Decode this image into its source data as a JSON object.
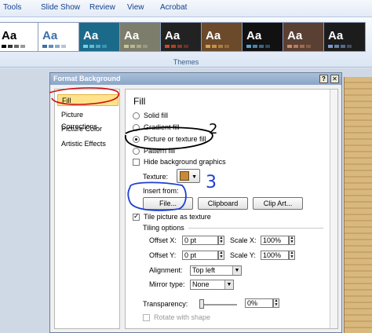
{
  "menubar": {
    "items": [
      "Tools",
      "Slide Show",
      "Review",
      "View",
      "Acrobat"
    ]
  },
  "ribbon": {
    "group_label": "Themes",
    "themes": [
      {
        "label": "Aa",
        "bg": "#ffffff",
        "fg": "#000000",
        "accent": "#000000"
      },
      {
        "label": "Aa",
        "bg": "#ffffff",
        "fg": "#3d6fa8",
        "accent": "#3d6fa8"
      },
      {
        "label": "Aa",
        "bg": "#1c6a8a",
        "fg": "#ffffff",
        "accent": "#6ad3ea"
      },
      {
        "label": "Aa",
        "bg": "#7d7d6b",
        "fg": "#ffffff",
        "accent": "#c9c59a"
      },
      {
        "label": "Aa",
        "bg": "#222222",
        "fg": "#ffffff",
        "accent": "#d0482a"
      },
      {
        "label": "Aa",
        "bg": "#6a4a2a",
        "fg": "#ffffff",
        "accent": "#d9a14c"
      },
      {
        "label": "Aa",
        "bg": "#111111",
        "fg": "#ffffff",
        "accent": "#5aa0d0"
      },
      {
        "label": "Aa",
        "bg": "#5a3f33",
        "fg": "#ffffff",
        "accent": "#c98b6a"
      },
      {
        "label": "Aa",
        "bg": "#1c1c1c",
        "fg": "#ffffff",
        "accent": "#7b9cd0"
      }
    ]
  },
  "dialog": {
    "title": "Format Background",
    "help": "?",
    "close": "✕",
    "nav": [
      "Fill",
      "Picture Corrections",
      "Picture Color",
      "Artistic Effects"
    ],
    "section": "Fill",
    "fill_options": [
      "Solid fill",
      "Gradient fill",
      "Picture or texture fill",
      "Pattern fill"
    ],
    "hide_bg": "Hide background graphics",
    "texture_label": "Texture:",
    "insert_from": "Insert from:",
    "file_btn": "File...",
    "clipboard_btn": "Clipboard",
    "clipart_btn": "Clip Art...",
    "tile_label": "Tile picture as texture",
    "tiling_label": "Tiling options",
    "offset_x_label": "Offset X:",
    "offset_x_value": "0 pt",
    "offset_y_label": "Offset Y:",
    "offset_y_value": "0 pt",
    "scale_x_label": "Scale X:",
    "scale_x_value": "100%",
    "scale_y_label": "Scale Y:",
    "scale_y_value": "100%",
    "alignment_label": "Alignment:",
    "alignment_value": "Top left",
    "mirror_label": "Mirror type:",
    "mirror_value": "None",
    "transparency_label": "Transparency:",
    "transparency_value": "0%",
    "rotate_label": "Rotate with shape"
  },
  "annotations": {
    "number_2": "2",
    "number_3": "3"
  }
}
